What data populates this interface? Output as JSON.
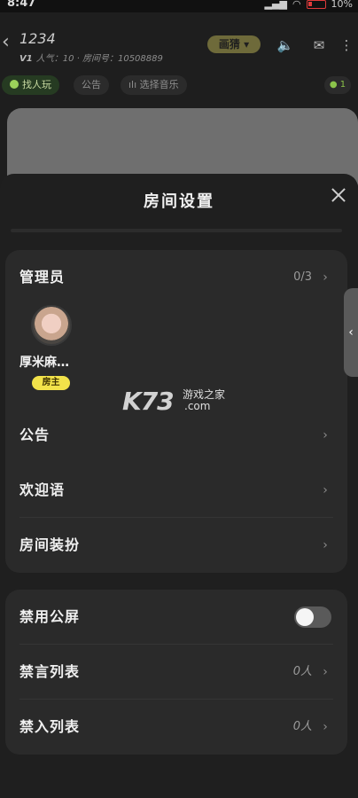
{
  "status_bar": {
    "time": "8:47",
    "battery": "10%"
  },
  "room": {
    "name": "1234",
    "level": "V1",
    "meta": "人气：10 · 房间号：10508889",
    "mode": "画猜",
    "chips": [
      "找人玩",
      "公告",
      "选择音乐"
    ],
    "online": "1"
  },
  "sheet": {
    "title": "房间设置",
    "admin_section": {
      "label": "管理员",
      "count": "0/3",
      "admins": [
        {
          "name": "厚米麻…",
          "badge": "房主"
        }
      ]
    },
    "rows_group1": [
      {
        "label": "公告"
      },
      {
        "label": "欢迎语"
      },
      {
        "label": "房间装扮"
      }
    ],
    "rows_group2": [
      {
        "label": "禁用公屏",
        "toggle": false
      },
      {
        "label": "禁言列表",
        "value": "0人"
      },
      {
        "label": "禁入列表",
        "value": "0人"
      }
    ]
  },
  "watermark": {
    "logo": "K73",
    "sub": "游戏之家",
    "domain": ".com"
  },
  "colors": {
    "sheet_bg": "#1f1f1f",
    "card_bg": "#2a2a2a",
    "badge_yellow": "#f2e24a"
  }
}
